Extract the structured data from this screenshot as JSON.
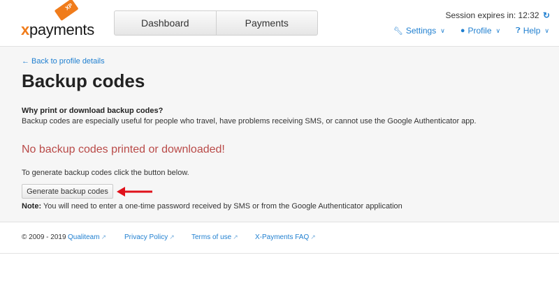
{
  "logo": {
    "x": "x",
    "rest": "payments",
    "badge": "XP"
  },
  "nav": {
    "dashboard": "Dashboard",
    "payments": "Payments"
  },
  "session": {
    "label": "Session expires in: 12:32",
    "refresh_icon": "refresh-icon"
  },
  "top_links": {
    "settings": "Settings",
    "profile": "Profile",
    "help": "Help"
  },
  "content": {
    "back_link": "← Back to profile details",
    "title": "Backup codes",
    "why_title": "Why print or download backup codes?",
    "why_text": "Backup codes are especially useful for people who travel, have problems receiving SMS, or cannot use the Google Authenticator app.",
    "warning": "No backup codes printed or downloaded!",
    "instruction": "To generate backup codes click the button below.",
    "generate_button": "Generate backup codes",
    "note_label": "Note:",
    "note_text": " You will need to enter a one-time password received by SMS or from the Google Authenticator application"
  },
  "footer": {
    "copyright": "© 2009 - 2019",
    "links": [
      "Qualiteam",
      "Privacy Policy",
      "Terms of use",
      "X-Payments FAQ"
    ]
  },
  "colors": {
    "accent": "#1f7fd0",
    "brand": "#f07c1b",
    "warning": "#b94a48",
    "arrow": "#e0111b"
  }
}
